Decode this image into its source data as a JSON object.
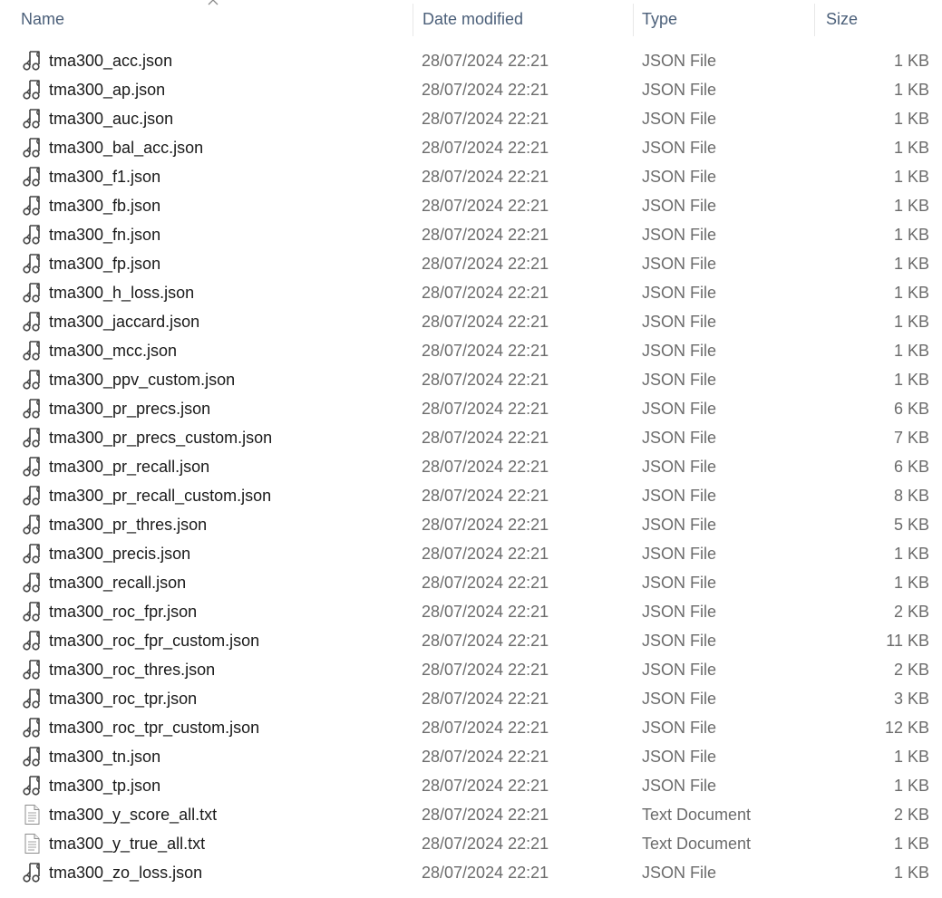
{
  "columns": {
    "name": "Name",
    "date_modified": "Date modified",
    "type": "Type",
    "size": "Size"
  },
  "sort": {
    "column": "name",
    "direction": "ascending",
    "icon": "chevron-up-icon"
  },
  "files": [
    {
      "name": "tma300_acc.json",
      "date": "28/07/2024 22:21",
      "type": "JSON File",
      "size": "1 KB",
      "icon": "json-file-icon"
    },
    {
      "name": "tma300_ap.json",
      "date": "28/07/2024 22:21",
      "type": "JSON File",
      "size": "1 KB",
      "icon": "json-file-icon"
    },
    {
      "name": "tma300_auc.json",
      "date": "28/07/2024 22:21",
      "type": "JSON File",
      "size": "1 KB",
      "icon": "json-file-icon"
    },
    {
      "name": "tma300_bal_acc.json",
      "date": "28/07/2024 22:21",
      "type": "JSON File",
      "size": "1 KB",
      "icon": "json-file-icon"
    },
    {
      "name": "tma300_f1.json",
      "date": "28/07/2024 22:21",
      "type": "JSON File",
      "size": "1 KB",
      "icon": "json-file-icon"
    },
    {
      "name": "tma300_fb.json",
      "date": "28/07/2024 22:21",
      "type": "JSON File",
      "size": "1 KB",
      "icon": "json-file-icon"
    },
    {
      "name": "tma300_fn.json",
      "date": "28/07/2024 22:21",
      "type": "JSON File",
      "size": "1 KB",
      "icon": "json-file-icon"
    },
    {
      "name": "tma300_fp.json",
      "date": "28/07/2024 22:21",
      "type": "JSON File",
      "size": "1 KB",
      "icon": "json-file-icon"
    },
    {
      "name": "tma300_h_loss.json",
      "date": "28/07/2024 22:21",
      "type": "JSON File",
      "size": "1 KB",
      "icon": "json-file-icon"
    },
    {
      "name": "tma300_jaccard.json",
      "date": "28/07/2024 22:21",
      "type": "JSON File",
      "size": "1 KB",
      "icon": "json-file-icon"
    },
    {
      "name": "tma300_mcc.json",
      "date": "28/07/2024 22:21",
      "type": "JSON File",
      "size": "1 KB",
      "icon": "json-file-icon"
    },
    {
      "name": "tma300_ppv_custom.json",
      "date": "28/07/2024 22:21",
      "type": "JSON File",
      "size": "1 KB",
      "icon": "json-file-icon"
    },
    {
      "name": "tma300_pr_precs.json",
      "date": "28/07/2024 22:21",
      "type": "JSON File",
      "size": "6 KB",
      "icon": "json-file-icon"
    },
    {
      "name": "tma300_pr_precs_custom.json",
      "date": "28/07/2024 22:21",
      "type": "JSON File",
      "size": "7 KB",
      "icon": "json-file-icon"
    },
    {
      "name": "tma300_pr_recall.json",
      "date": "28/07/2024 22:21",
      "type": "JSON File",
      "size": "6 KB",
      "icon": "json-file-icon"
    },
    {
      "name": "tma300_pr_recall_custom.json",
      "date": "28/07/2024 22:21",
      "type": "JSON File",
      "size": "8 KB",
      "icon": "json-file-icon"
    },
    {
      "name": "tma300_pr_thres.json",
      "date": "28/07/2024 22:21",
      "type": "JSON File",
      "size": "5 KB",
      "icon": "json-file-icon"
    },
    {
      "name": "tma300_precis.json",
      "date": "28/07/2024 22:21",
      "type": "JSON File",
      "size": "1 KB",
      "icon": "json-file-icon"
    },
    {
      "name": "tma300_recall.json",
      "date": "28/07/2024 22:21",
      "type": "JSON File",
      "size": "1 KB",
      "icon": "json-file-icon"
    },
    {
      "name": "tma300_roc_fpr.json",
      "date": "28/07/2024 22:21",
      "type": "JSON File",
      "size": "2 KB",
      "icon": "json-file-icon"
    },
    {
      "name": "tma300_roc_fpr_custom.json",
      "date": "28/07/2024 22:21",
      "type": "JSON File",
      "size": "11 KB",
      "icon": "json-file-icon"
    },
    {
      "name": "tma300_roc_thres.json",
      "date": "28/07/2024 22:21",
      "type": "JSON File",
      "size": "2 KB",
      "icon": "json-file-icon"
    },
    {
      "name": "tma300_roc_tpr.json",
      "date": "28/07/2024 22:21",
      "type": "JSON File",
      "size": "3 KB",
      "icon": "json-file-icon"
    },
    {
      "name": "tma300_roc_tpr_custom.json",
      "date": "28/07/2024 22:21",
      "type": "JSON File",
      "size": "12 KB",
      "icon": "json-file-icon"
    },
    {
      "name": "tma300_tn.json",
      "date": "28/07/2024 22:21",
      "type": "JSON File",
      "size": "1 KB",
      "icon": "json-file-icon"
    },
    {
      "name": "tma300_tp.json",
      "date": "28/07/2024 22:21",
      "type": "JSON File",
      "size": "1 KB",
      "icon": "json-file-icon"
    },
    {
      "name": "tma300_y_score_all.txt",
      "date": "28/07/2024 22:21",
      "type": "Text Document",
      "size": "2 KB",
      "icon": "text-file-icon"
    },
    {
      "name": "tma300_y_true_all.txt",
      "date": "28/07/2024 22:21",
      "type": "Text Document",
      "size": "1 KB",
      "icon": "text-file-icon"
    },
    {
      "name": "tma300_zo_loss.json",
      "date": "28/07/2024 22:21",
      "type": "JSON File",
      "size": "1 KB",
      "icon": "json-file-icon"
    }
  ]
}
